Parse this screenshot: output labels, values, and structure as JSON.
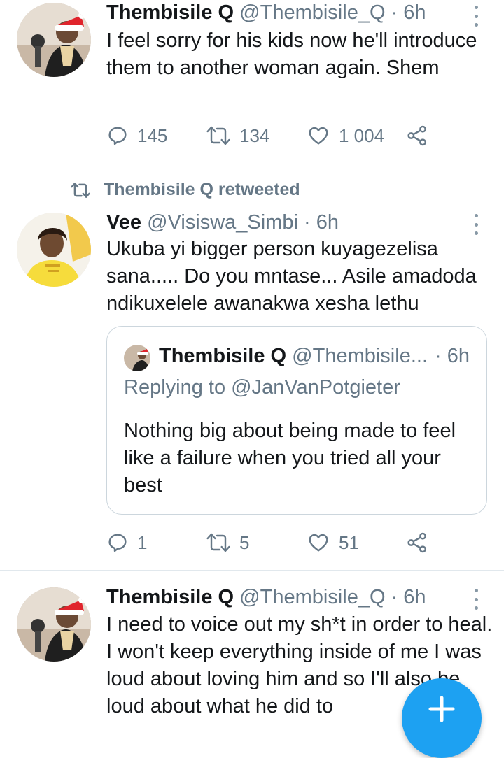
{
  "colors": {
    "accent": "#1da1f2",
    "text": "#14171a",
    "muted": "#657786",
    "border": "#e1e8ed"
  },
  "tweet1": {
    "name": "Thembisile Q",
    "handle": "@Thembisile_Q",
    "time": "· 6h",
    "text": "I feel sorry for his kids now he'll introduce them to another woman again. Shem",
    "replies": "145",
    "retweets": "134",
    "likes": "1 004"
  },
  "retweet_banner": {
    "label": "Thembisile Q retweeted"
  },
  "tweet2": {
    "name": "Vee",
    "handle": "@Visiswa_Simbi",
    "time": "· 6h",
    "text": "Ukuba yi bigger person kuyagezelisa sana..... Do you mntase... Asile amadoda ndikuxelele awanakwa xesha lethu",
    "quote": {
      "name": "Thembisile Q",
      "handle": "@Thembisile...",
      "time": "· 6h",
      "replying": "Replying to @JanVanPotgieter",
      "text": "Nothing big about being made to feel like a failure when you tried all your best"
    },
    "replies": "1",
    "retweets": "5",
    "likes": "51"
  },
  "tweet3": {
    "name": "Thembisile Q",
    "handle": "@Thembisile_Q",
    "time": "· 6h",
    "text": "I need to voice out my sh*t in order to heal. I won't keep everything inside of me I was loud about loving him and so I'll also be loud about what he did to"
  },
  "icons": {
    "reply": "reply-icon",
    "retweet": "retweet-icon",
    "like": "heart-icon",
    "share": "share-icon",
    "more": "more-vertical-icon",
    "compose": "plus-icon"
  }
}
